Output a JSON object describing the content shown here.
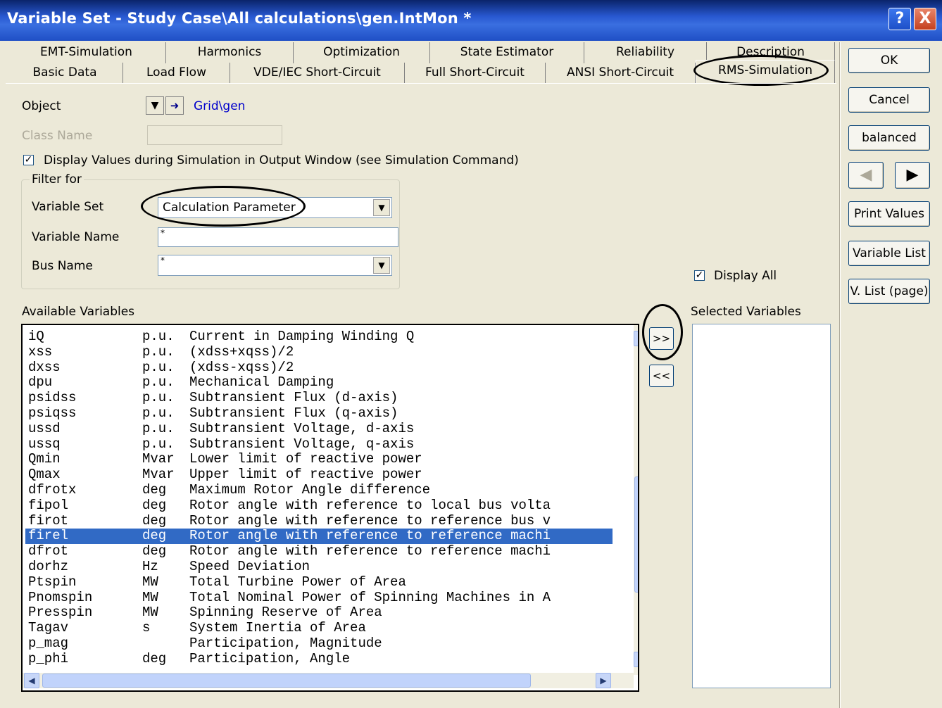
{
  "window": {
    "title": "Variable Set - Study Case\\All calculations\\gen.IntMon *",
    "help": "?",
    "close": "X"
  },
  "tabs_row1": [
    "EMT-Simulation",
    "Harmonics",
    "Optimization",
    "State Estimator",
    "Reliability",
    "Description"
  ],
  "tabs_row2": [
    "Basic Data",
    "Load Flow",
    "VDE/IEC Short-Circuit",
    "Full Short-Circuit",
    "ANSI Short-Circuit",
    "RMS-Simulation"
  ],
  "active_tab": "RMS-Simulation",
  "buttons": {
    "ok": "OK",
    "cancel": "Cancel",
    "balanced": "balanced",
    "print_values": "Print Values",
    "variable_list": "Variable List",
    "v_list_page": "V. List (page)"
  },
  "object": {
    "label": "Object",
    "value": "Grid\\gen"
  },
  "class_name": {
    "label": "Class Name",
    "value": ""
  },
  "display_values": {
    "label": "Display Values during Simulation in Output Window (see Simulation Command)",
    "checked": true
  },
  "filter": {
    "legend": "Filter for",
    "variable_set_label": "Variable Set",
    "variable_set_value": "Calculation Parameter",
    "variable_name_label": "Variable Name",
    "variable_name_value": "*",
    "bus_name_label": "Bus Name",
    "bus_name_value": "*"
  },
  "display_all": {
    "label": "Display All",
    "checked": true
  },
  "available_label": "Available Variables",
  "selected_label": "Selected Variables",
  "move_right": ">>",
  "move_left": "<<",
  "variables": [
    {
      "name": "iQ",
      "unit": "p.u.",
      "desc": "Current in Damping Winding Q"
    },
    {
      "name": "xss",
      "unit": "p.u.",
      "desc": "(xdss+xqss)/2"
    },
    {
      "name": "dxss",
      "unit": "p.u.",
      "desc": "(xdss-xqss)/2"
    },
    {
      "name": "dpu",
      "unit": "p.u.",
      "desc": "Mechanical Damping"
    },
    {
      "name": "psidss",
      "unit": "p.u.",
      "desc": "Subtransient Flux (d-axis)"
    },
    {
      "name": "psiqss",
      "unit": "p.u.",
      "desc": "Subtransient Flux (q-axis)"
    },
    {
      "name": "ussd",
      "unit": "p.u.",
      "desc": "Subtransient Voltage, d-axis"
    },
    {
      "name": "ussq",
      "unit": "p.u.",
      "desc": "Subtransient Voltage, q-axis"
    },
    {
      "name": "Qmin",
      "unit": "Mvar",
      "desc": "Lower limit of reactive power"
    },
    {
      "name": "Qmax",
      "unit": "Mvar",
      "desc": "Upper limit of reactive power"
    },
    {
      "name": "dfrotx",
      "unit": "deg",
      "desc": "Maximum Rotor Angle difference"
    },
    {
      "name": "fipol",
      "unit": "deg",
      "desc": "Rotor angle with reference to local bus volta"
    },
    {
      "name": "firot",
      "unit": "deg",
      "desc": "Rotor angle with reference to reference bus v"
    },
    {
      "name": "firel",
      "unit": "deg",
      "desc": "Rotor angle with reference to reference machi",
      "selected": true
    },
    {
      "name": "dfrot",
      "unit": "deg",
      "desc": "Rotor angle with reference to reference machi"
    },
    {
      "name": "dorhz",
      "unit": "Hz",
      "desc": "Speed Deviation"
    },
    {
      "name": "Ptspin",
      "unit": "MW",
      "desc": "Total Turbine Power of Area"
    },
    {
      "name": "Pnomspin",
      "unit": "MW",
      "desc": "Total Nominal Power of Spinning Machines in A"
    },
    {
      "name": "Presspin",
      "unit": "MW",
      "desc": "Spinning Reserve of Area"
    },
    {
      "name": "Tagav",
      "unit": "s",
      "desc": "System Inertia of Area"
    },
    {
      "name": "p_mag",
      "unit": "",
      "desc": "Participation, Magnitude"
    },
    {
      "name": "p_phi",
      "unit": "deg",
      "desc": "Participation, Angle"
    }
  ]
}
